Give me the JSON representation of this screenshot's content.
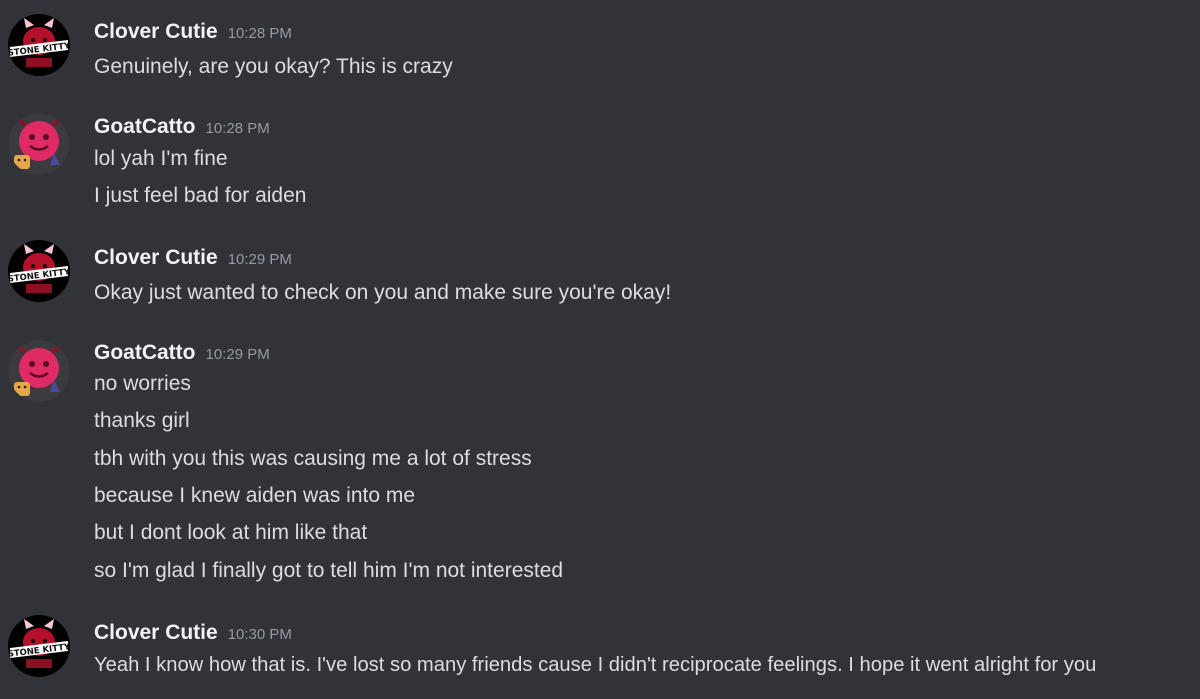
{
  "messages": [
    {
      "author": "Clover Cutie",
      "time": "10:28 PM",
      "avatar": "clover-cutie-avatar",
      "avatar_text": "STONE KITTY",
      "lines": [
        "Genuinely, are you okay? This is crazy"
      ]
    },
    {
      "author": "GoatCatto",
      "time": "10:28 PM",
      "avatar": "goatcatto-avatar",
      "lines": [
        "lol yah I'm fine",
        "I just feel bad for aiden"
      ]
    },
    {
      "author": "Clover Cutie",
      "time": "10:29 PM",
      "avatar": "clover-cutie-avatar",
      "avatar_text": "STONE KITTY",
      "lines": [
        "Okay just wanted to check on you and make sure you're okay!"
      ]
    },
    {
      "author": "GoatCatto",
      "time": "10:29 PM",
      "avatar": "goatcatto-avatar",
      "lines": [
        "no worries",
        "thanks girl",
        "tbh with you this was causing me a lot of stress",
        "because I knew aiden was into me",
        "but I dont look at him like that",
        "so I'm glad I finally got to tell him I'm not interested"
      ]
    },
    {
      "author": "Clover Cutie",
      "time": "10:30 PM",
      "avatar": "clover-cutie-avatar",
      "avatar_text": "STONE KITTY",
      "lines": [
        "Yeah I know how that is. I've lost so many friends cause I didn't reciprocate feelings. I hope it went alright for you"
      ]
    }
  ],
  "colors": {
    "background": "#313338",
    "author": "#f2f3f5",
    "timestamp": "#949ba4",
    "text": "#dbdee1"
  }
}
